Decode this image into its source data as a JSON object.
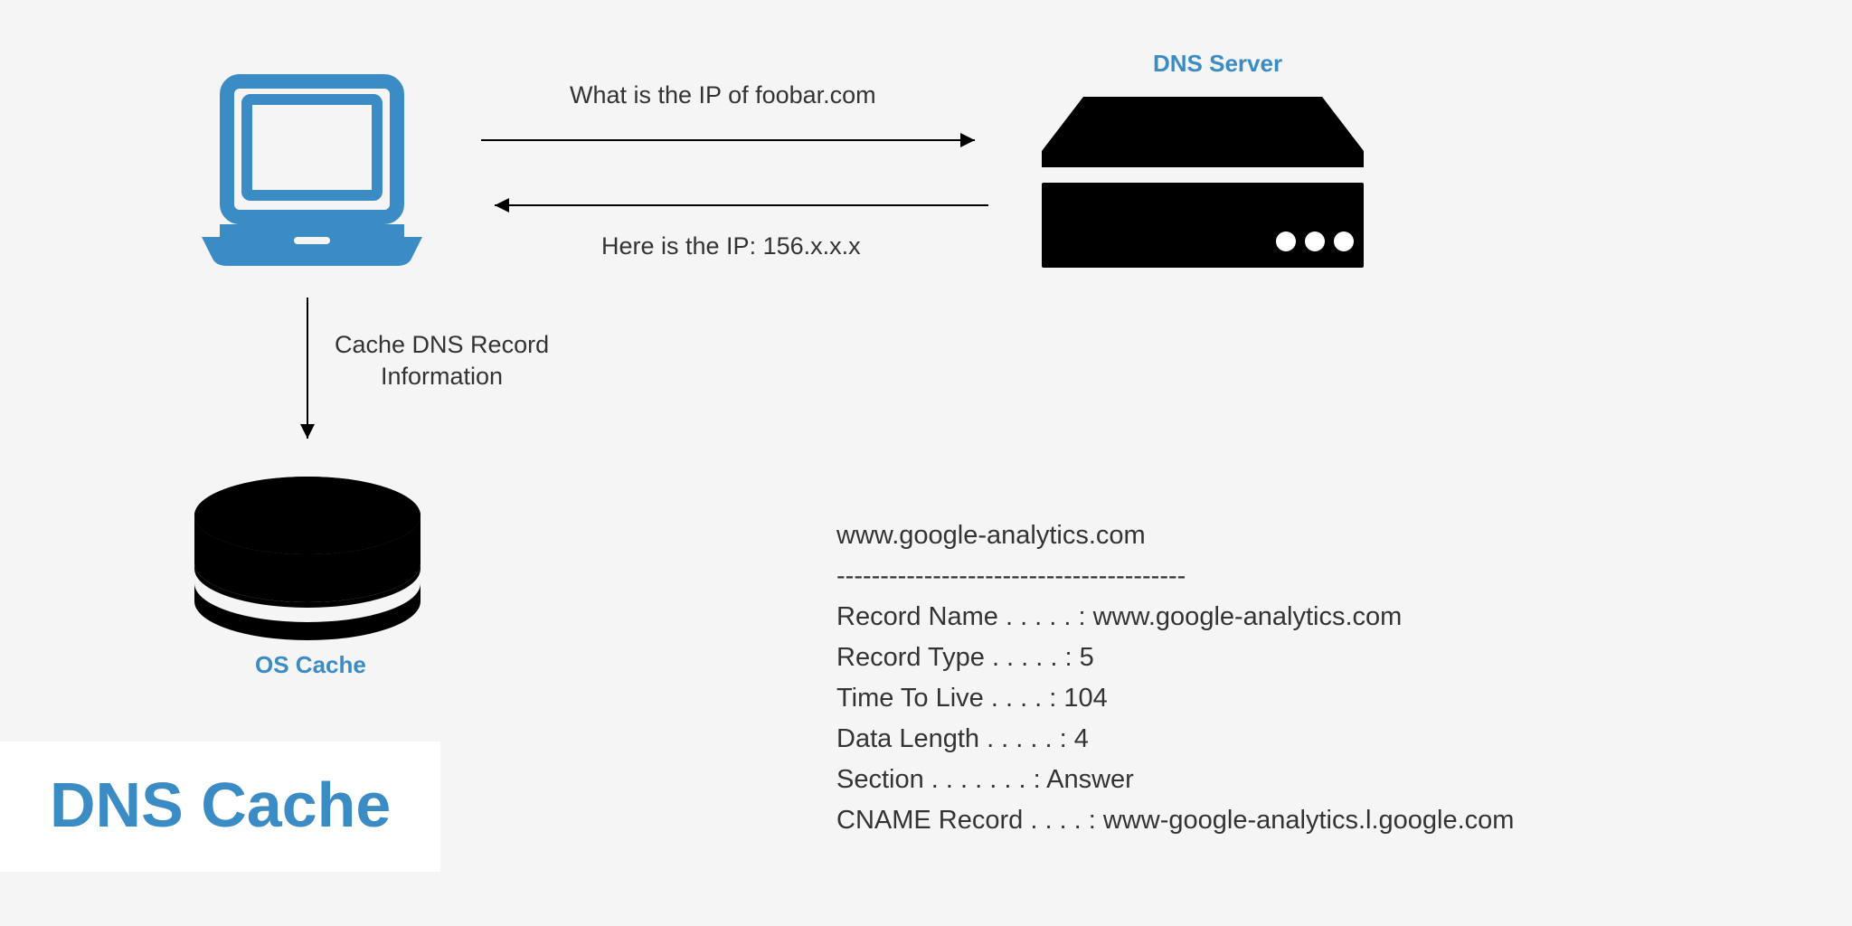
{
  "labels": {
    "dns_server": "DNS Server",
    "os_cache": "OS Cache",
    "title": "DNS Cache"
  },
  "arrows": {
    "request": "What is the IP of foobar.com",
    "response": "Here is the IP: 156.x.x.x",
    "cache_line1": "Cache DNS Record",
    "cache_line2": "Information"
  },
  "record": {
    "host": "www.google-analytics.com",
    "separator": "----------------------------------------",
    "lines": {
      "record_name": "Record Name . . . . . : www.google-analytics.com",
      "record_type": "Record Type . . . . . : 5",
      "ttl": "Time To Live  . . . . : 104",
      "data_length": "Data Length . . . . . : 4",
      "section": "Section . . . . . . . : Answer",
      "cname": "CNAME Record  . . . . : www-google-analytics.l.google.com"
    }
  }
}
